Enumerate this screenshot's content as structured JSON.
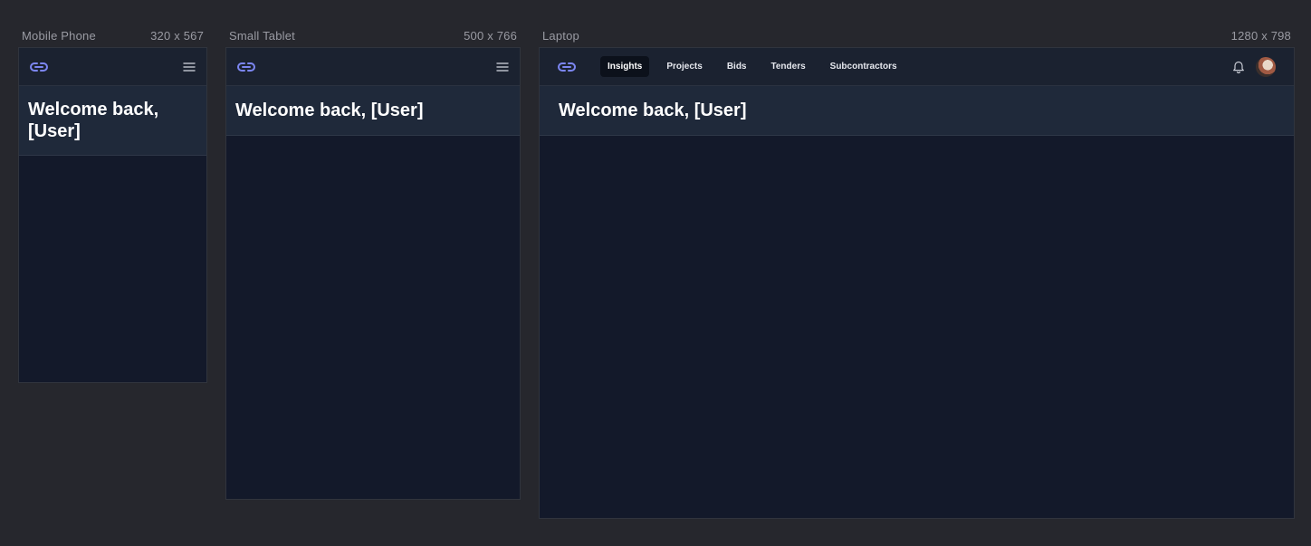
{
  "frames": {
    "mobile": {
      "label": "Mobile Phone",
      "size": "320 x 567"
    },
    "tablet": {
      "label": "Small Tablet",
      "size": "500 x 766"
    },
    "laptop": {
      "label": "Laptop",
      "size": "1280 x 798"
    }
  },
  "header": {
    "welcome": "Welcome back, [User]",
    "welcome_line1": "Welcome back,",
    "welcome_line2": "[User]"
  },
  "nav": {
    "items": [
      "Insights",
      "Projects",
      "Bids",
      "Tenders",
      "Subcontractors"
    ],
    "active": "Insights"
  },
  "icons": {
    "logo": "link-icon",
    "menu": "hamburger-menu-icon",
    "notifications": "bell-icon",
    "avatar": "user-avatar"
  },
  "colors": {
    "canvas": "#26272d",
    "frame_bg": "#13192a",
    "topbar_bg": "#1b2230",
    "welcome_bg": "#1f293a",
    "accent_icon": "#7c86f2",
    "text_primary": "#ffffff"
  }
}
